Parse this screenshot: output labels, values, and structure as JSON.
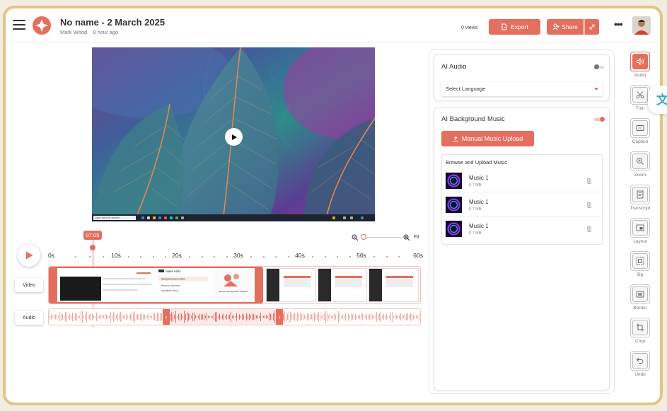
{
  "header": {
    "title": "No name - 2 March 2025",
    "author": "Mark Wood",
    "time_ago": "8 hour ago",
    "views": "0 views",
    "export_label": "Export",
    "share_label": "Share"
  },
  "video": {
    "taskbar_search": "Type here to search"
  },
  "zoom": {
    "fit_label": "Fit",
    "level": 0.05
  },
  "timeline": {
    "playhead_time": "07:05",
    "ticks": [
      "0s",
      "10s",
      "20s",
      "30s",
      "40s",
      "50s",
      "60s"
    ],
    "video_track_label": "Video",
    "audio_track_label": "Audio",
    "clip1_texts": {
      "heading": "Make edits",
      "item1": "Add price/menu video",
      "item2": "Remove Element",
      "item3": "Available Music",
      "tagline": "World's Strong Better Together"
    }
  },
  "panel": {
    "ai_audio": {
      "title": "AI Audio",
      "enabled": false,
      "select_placeholder": "Select Language"
    },
    "ai_bg_music": {
      "title": "AI Background Music",
      "enabled": true,
      "upload_label": "Manual Music Upload",
      "browse_title": "Browse and Upload Music",
      "tracks": [
        {
          "name": "Music 1",
          "size": "5.7 MB"
        },
        {
          "name": "Music 1",
          "size": "5.7 MB"
        },
        {
          "name": "Music 1",
          "size": "5.7 MB"
        }
      ]
    }
  },
  "tools": [
    {
      "label": "Audio",
      "icon": "speaker-icon",
      "active": true
    },
    {
      "label": "Trim",
      "icon": "scissors-icon",
      "active": false
    },
    {
      "label": "Caption",
      "icon": "cc-icon",
      "active": false
    },
    {
      "label": "Zoom",
      "icon": "zoom-icon",
      "active": false
    },
    {
      "label": "Transcript",
      "icon": "transcript-icon",
      "active": false
    },
    {
      "label": "Layout",
      "icon": "layout-icon",
      "active": false
    },
    {
      "label": "Bg",
      "icon": "background-icon",
      "active": false
    },
    {
      "label": "Border",
      "icon": "border-icon",
      "active": false
    },
    {
      "label": "Crop",
      "icon": "crop-icon",
      "active": false
    },
    {
      "label": "Undo",
      "icon": "undo-icon",
      "active": false
    }
  ],
  "colors": {
    "accent": "#e46f5f",
    "frame_border": "#e4c486"
  }
}
